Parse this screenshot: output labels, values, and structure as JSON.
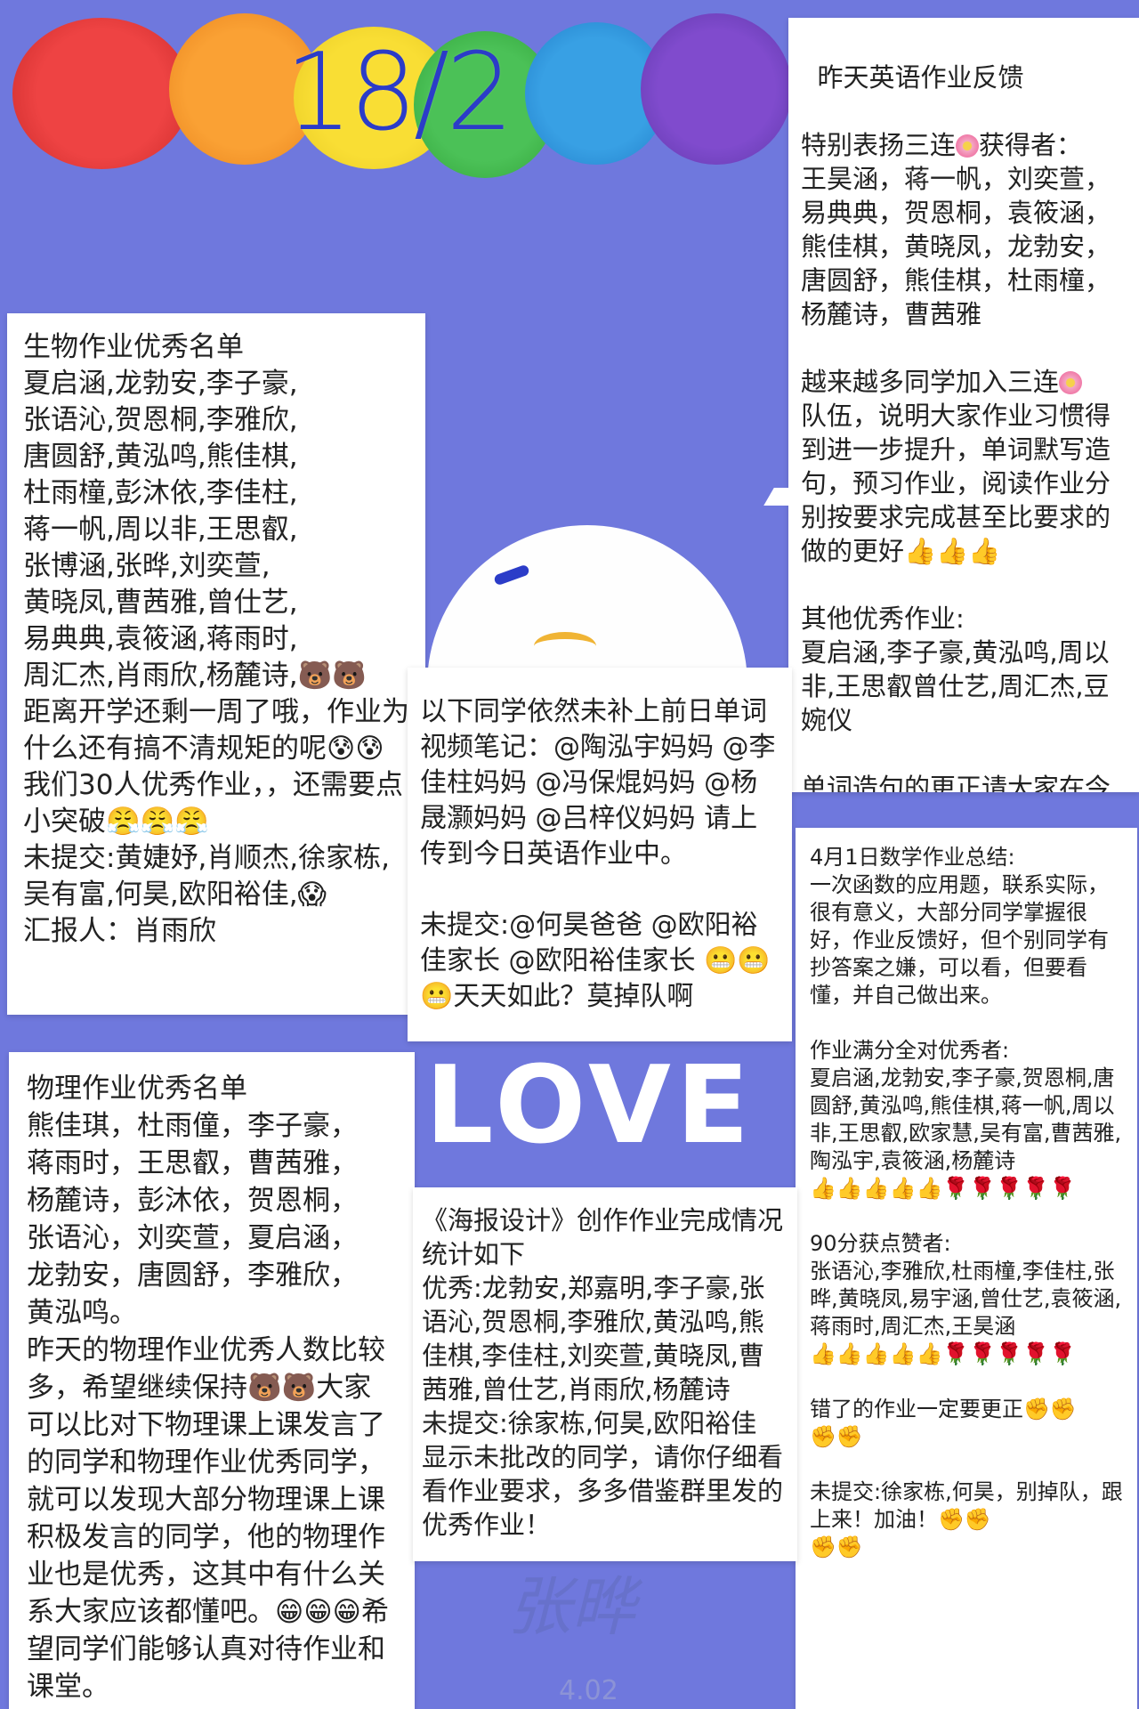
{
  "header": {
    "date": "18/2"
  },
  "colors": {
    "background": "#6f78dd",
    "title": "#2b3cc8"
  },
  "english_card": {
    "title": "昨天英语作业反馈",
    "praise_intro": "特别表扬三连",
    "praise_suffix": "获得者：",
    "praise_names": "王昊涵，蒋一帆，刘奕萱，\n易典典，贺恩桐，袁筱涵，\n熊佳棋，黄晓凤，龙勃安，\n唐圆舒，熊佳棋，杜雨橦，\n杨麓诗，曹茜雅",
    "join_prefix": "越来越多同学加入三连",
    "join_body": "\n队伍，说明大家作业习惯得到进一步提升，单词默写造句，预习作业，阅读作业分别按要求完成甚至比要求的做的更好👍👍👍",
    "other_title": "其他优秀作业:",
    "other_names": "夏启涵,李子豪,黄泓鸣,周以非,王思叡曾仕艺,周汇杰,豆婉仪",
    "correction": "单词造句的更正请大家在今天作业里上传给我看。"
  },
  "biology_card": {
    "text": "生物作业优秀名单\n夏启涵,龙勃安,李子豪,\n张语沁,贺恩桐,李雅欣,\n唐圆舒,黄泓鸣,熊佳棋,\n杜雨橦,彭沐依,李佳柱,\n蒋一帆,周以非,王思叡,\n张博涵,张晔,刘奕萱,\n黄晓凤,曹茜雅,曾仕艺,\n易典典,袁筱涵,蒋雨时,\n周汇杰,肖雨欣,杨麓诗,🐻🐻\n距离开学还剩一周了哦，作业为什么还有搞不清规矩的呢😰😰\n我们30人优秀作业，，还需要点小突破😤😤😤\n未提交:黄婕妤,肖顺杰,徐家栋,吴有富,何昊,欧阳裕佳,😱\n汇报人：肖雨欣"
  },
  "middle_card": {
    "text": "以下同学依然未补上前日单词视频笔记：@陶泓宇妈妈 @李佳柱妈妈 @冯保焜妈妈 @杨晟灏妈妈 @吕梓仪妈妈 请上传到今日英语作业中。\n\n未提交:@何昊爸爸 @欧阳裕佳家长 @欧阳裕佳家长 😬😬😬天天如此？莫掉队啊"
  },
  "math_card": {
    "text": "4月1日数学作业总结:\n一次函数的应用题，联系实际，很有意义，大部分同学掌握很好，作业反馈好，但个别同学有抄答案之嫌，可以看，但要看懂，并自己做出来。\n\n作业满分全对优秀者:\n夏启涵,龙勃安,李子豪,贺恩桐,唐圆舒,黄泓鸣,熊佳棋,蒋一帆,周以非,王思叡,欧家慧,吴有富,曹茜雅,陶泓宇,袁筱涵,杨麓诗\n👍👍👍👍👍🌹🌹🌹🌹🌹\n\n90分获点赞者:\n张语沁,李雅欣,杜雨橦,李佳柱,张晔,黄晓凤,易宇涵,曾仕艺,袁筱涵,蒋雨时,周汇杰,王昊涵\n👍👍👍👍👍🌹🌹🌹🌹🌹\n\n错了的作业一定要更正✊✊\n✊✊\n\n未提交:徐家栋,何昊，别掉队，跟上来！加油！✊✊\n✊✊"
  },
  "physics_card": {
    "text": "物理作业优秀名单\n熊佳琪，杜雨僮，李子豪，\n蒋雨时，王思叡，曹茜雅，\n杨麓诗，彭沐依，贺恩桐，\n张语沁，刘奕萱，夏启涵，\n龙勃安，唐圆舒，李雅欣，\n黄泓鸣。\n昨天的物理作业优秀人数比较多，希望继续保持🐻🐻大家可以比对下物理课上课发言了的同学和物理作业优秀同学，就可以发现大部分物理课上课积极发言的同学，他的物理作业也是优秀，这其中有什么关系大家应该都懂吧。😁😁😁希望同学们能够认真对待作业和课堂。"
  },
  "poster_card": {
    "text": "《海报设计》创作作业完成情况统计如下\n优秀:龙勃安,郑嘉明,李子豪,张语沁,贺恩桐,李雅欣,黄泓鸣,熊佳棋,李佳柱,刘奕萱,黄晓凤,曹茜雅,曾仕艺,肖雨欣,杨麓诗\n未提交:徐家栋,何昊,欧阳裕佳\n显示未批改的同学，请你仔细看看作业要求，多多借鉴群里发的优秀作业！"
  },
  "decor": {
    "love": "LOVE",
    "signature": "张晔",
    "signature_date": "4.02"
  }
}
